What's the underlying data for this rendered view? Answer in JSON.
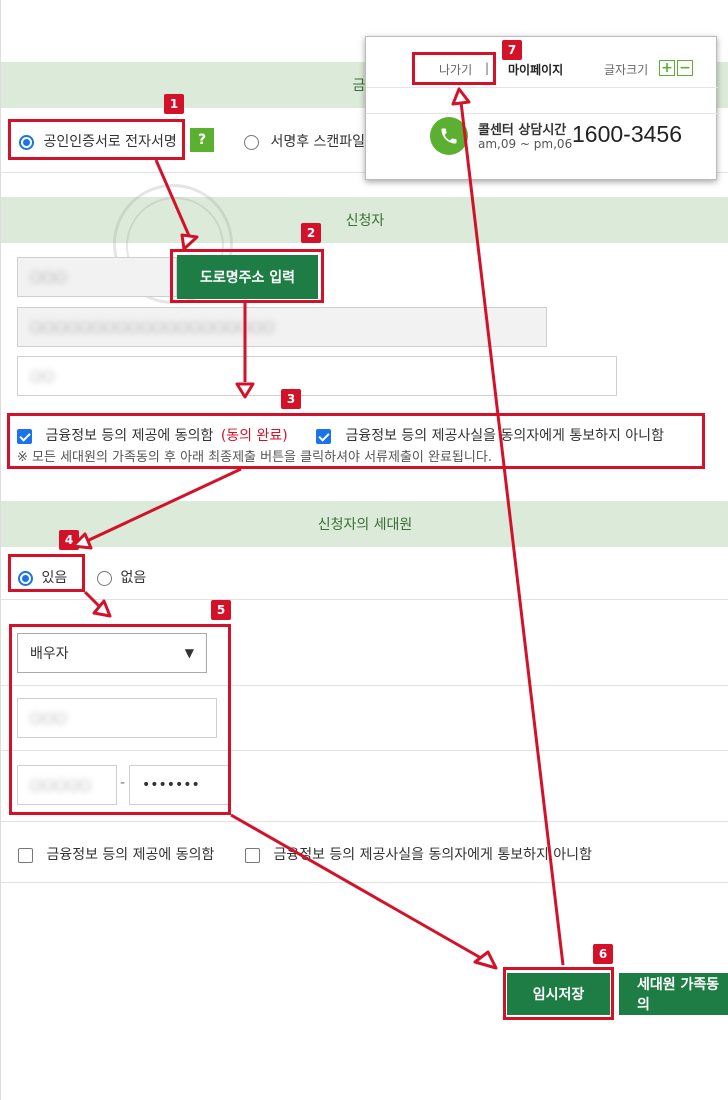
{
  "sign_section": {
    "title_partial": "금",
    "option_cert": "공인인증서로 전자서명",
    "help": "?",
    "option_scan": "서명후 스캔파일"
  },
  "applicant": {
    "title": "신청자",
    "name_value": "○○○",
    "road_button": "도로명주소 입력",
    "address_value": "○○○○○○○○○○○○○○○○○○○○",
    "detail_value": "○○"
  },
  "consent": {
    "agree_label": "금융정보 등의 제공에 동의함",
    "agree_status": "(동의 완료)",
    "no_notify_label": "금융정보 등의 제공사실을 동의자에게 통보하지 아니함",
    "notice": "※ 모든 세대원의 가족동의 후 아래 최종제출 버튼을 클릭하셔야 서류제출이 완료됩니다."
  },
  "household": {
    "title": "신청자의 세대원",
    "option_yes": "있음",
    "option_no": "없음",
    "relation_value": "배우자",
    "name_value": "○○○",
    "id_front": "○○○○○",
    "id_sep": "-",
    "id_back": "•••••••",
    "agree_label": "금융정보 등의 제공에 동의함",
    "no_notify_label": "금융정보 등의 제공사실을 동의자에게 통보하지 아니함"
  },
  "buttons": {
    "temp_save": "임시저장",
    "family_consent": "세대원 가족동의"
  },
  "popup": {
    "logout": "나가기",
    "divider": "|",
    "mypage": "마이페이지",
    "font_size": "글자크기",
    "plus": "+",
    "minus": "−",
    "center_label": "콜센터 상담시간",
    "hours": "am,09 ~ pm,06",
    "phone": "1600-3456"
  },
  "badges": [
    "1",
    "2",
    "3",
    "4",
    "5",
    "6",
    "7"
  ],
  "colors": {
    "accent_green": "#1e7d45",
    "band_green": "#dcebd9",
    "annotation_red": "#d3122a",
    "radio_blue": "#1a73e8"
  }
}
